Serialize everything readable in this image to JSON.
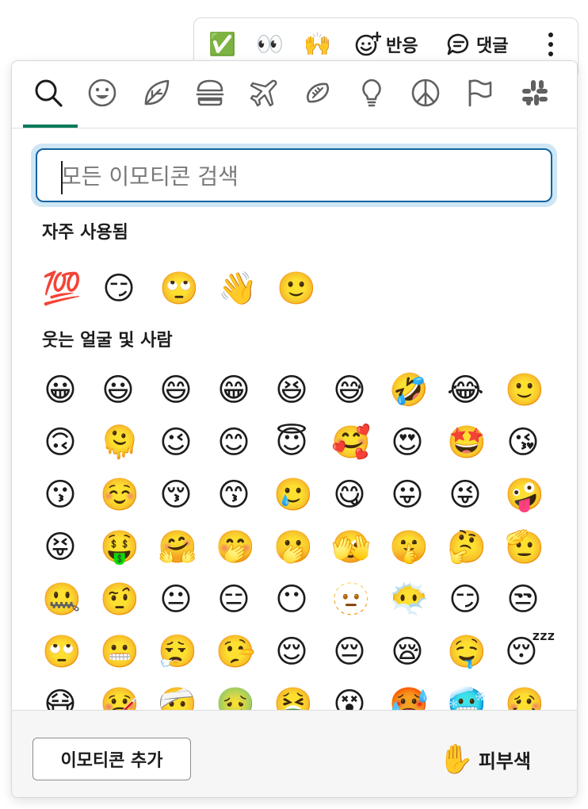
{
  "message_toolbar": {
    "quick_reactions": [
      "✅",
      "👀",
      "🙌"
    ],
    "react_label": "반응",
    "reply_label": "댓글",
    "icons": [
      "add-reaction-icon",
      "reply-icon",
      "more-vertical-icon"
    ]
  },
  "picker": {
    "tabs": [
      {
        "name": "search",
        "icon": "search-icon",
        "active": true
      },
      {
        "name": "smileys",
        "icon": "smiley-icon"
      },
      {
        "name": "nature",
        "icon": "leaf-icon"
      },
      {
        "name": "food",
        "icon": "burger-icon"
      },
      {
        "name": "travel",
        "icon": "airplane-icon"
      },
      {
        "name": "activities",
        "icon": "football-icon"
      },
      {
        "name": "objects",
        "icon": "lightbulb-icon"
      },
      {
        "name": "symbols",
        "icon": "peace-icon"
      },
      {
        "name": "flags",
        "icon": "flag-icon"
      },
      {
        "name": "custom",
        "icon": "slack-icon"
      }
    ],
    "accent_color": "#007a5a",
    "search": {
      "placeholder": "모든 이모티콘 검색",
      "value": ""
    },
    "frequent_title": "자주 사용됨",
    "frequent": [
      "💯",
      "😏",
      "🙄",
      "👋",
      "🙂"
    ],
    "smileys_title": "웃는 얼굴 및 사람",
    "smileys": [
      "😀",
      "😃",
      "😄",
      "😁",
      "😆",
      "😅",
      "🤣",
      "😂",
      "🙂",
      "🙃",
      "🫠",
      "😉",
      "😊",
      "😇",
      "🥰",
      "😍",
      "🤩",
      "😘",
      "😗",
      "☺️",
      "😚",
      "😙",
      "🥲",
      "😋",
      "😛",
      "😜",
      "🤪",
      "😝",
      "🤑",
      "🤗",
      "🤭",
      "🫢",
      "🫣",
      "🤫",
      "🤔",
      "🫡",
      "🤐",
      "🤨",
      "😐",
      "😑",
      "😶",
      "🫥",
      "😶‍🌫️",
      "😏",
      "😒",
      "🙄",
      "😬",
      "😮‍💨",
      "🤥",
      "😌",
      "😔",
      "😪",
      "🤤",
      "😴",
      "😷",
      "🤒",
      "🤕",
      "🤢",
      "🤮",
      "😵",
      "🥵",
      "🥶",
      "🥴"
    ],
    "footer": {
      "add_label": "이모티콘 추가",
      "skin_icon": "✋",
      "skin_label": "피부색"
    }
  }
}
